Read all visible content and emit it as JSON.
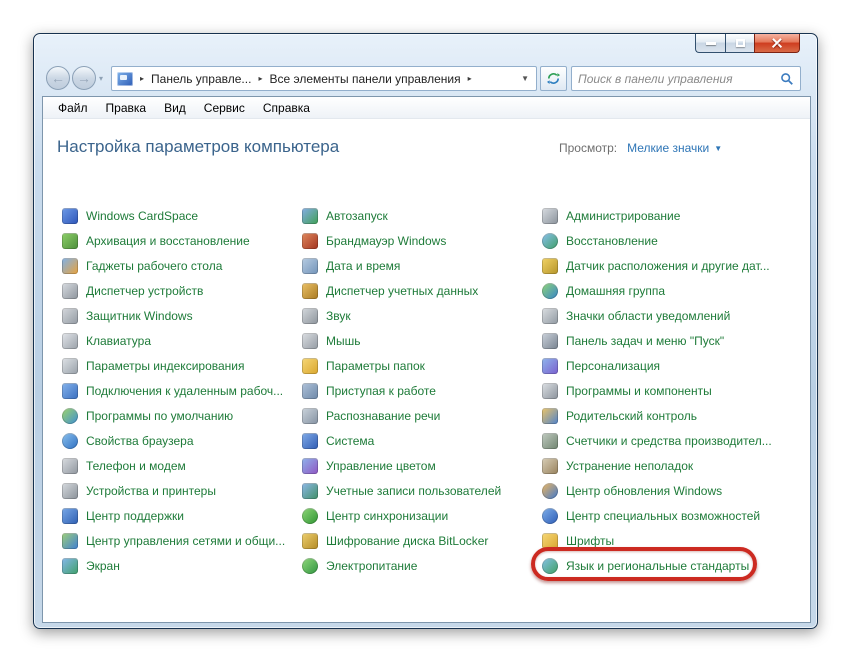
{
  "navigation": {
    "breadcrumb": {
      "items": [
        "Панель управле...",
        "Все элементы панели управления"
      ]
    },
    "search": {
      "placeholder": "Поиск в панели управления"
    }
  },
  "menu": {
    "items": [
      "Файл",
      "Правка",
      "Вид",
      "Сервис",
      "Справка"
    ]
  },
  "page": {
    "title": "Настройка параметров компьютера",
    "view_label": "Просмотр:",
    "view_value": "Мелкие значки"
  },
  "colors": {
    "item_link": "#1e7b39",
    "page_title": "#3b648c",
    "view_link": "#2e75b6",
    "view_label": "#6e6e6e",
    "menu_text": "#000000",
    "placeholder_gray": "#8a8a8a",
    "highlight_red": "#cc2a21"
  },
  "columns": [
    {
      "items": [
        {
          "label": "Windows CardSpace",
          "icon": "cardspace",
          "shape": "square",
          "colors": [
            "#6f9ce8",
            "#2d55b8"
          ]
        },
        {
          "label": "Архивация и восстановление",
          "icon": "backup-restore",
          "shape": "square",
          "colors": [
            "#8fd06a",
            "#4c8f3a"
          ]
        },
        {
          "label": "Гаджеты рабочего стола",
          "icon": "desktop-gadgets",
          "shape": "square",
          "colors": [
            "#7fb2ea",
            "#e9a23b"
          ]
        },
        {
          "label": "Диспетчер устройств",
          "icon": "device-manager",
          "shape": "square",
          "colors": [
            "#d9dde2",
            "#8d949c"
          ]
        },
        {
          "label": "Защитник Windows",
          "icon": "windows-defender",
          "shape": "square",
          "colors": [
            "#d6d9dd",
            "#939aa3"
          ]
        },
        {
          "label": "Клавиатура",
          "icon": "keyboard",
          "shape": "square",
          "colors": [
            "#e3e6ea",
            "#9aa1a9"
          ]
        },
        {
          "label": "Параметры индексирования",
          "icon": "indexing-options",
          "shape": "square",
          "colors": [
            "#dfe3e7",
            "#98a0a8"
          ]
        },
        {
          "label": "Подключения к удаленным рабоч...",
          "icon": "remote-desktop",
          "shape": "square",
          "colors": [
            "#86b4ec",
            "#3a6fc0"
          ]
        },
        {
          "label": "Программы по умолчанию",
          "icon": "default-programs",
          "shape": "circle",
          "colors": [
            "#9fd66a",
            "#3f8fd2"
          ]
        },
        {
          "label": "Свойства браузера",
          "icon": "internet-options",
          "shape": "circle",
          "colors": [
            "#8cc2ee",
            "#2d6fc2"
          ]
        },
        {
          "label": "Телефон и модем",
          "icon": "phone-modem",
          "shape": "square",
          "colors": [
            "#dadde1",
            "#8f969e"
          ]
        },
        {
          "label": "Устройства и принтеры",
          "icon": "devices-printers",
          "shape": "square",
          "colors": [
            "#d7dbdf",
            "#8a9199"
          ]
        },
        {
          "label": "Центр поддержки",
          "icon": "action-center-flag",
          "shape": "square",
          "colors": [
            "#79a9e8",
            "#2f5fb2"
          ]
        },
        {
          "label": "Центр управления сетями и общи...",
          "icon": "network-sharing-center",
          "shape": "square",
          "colors": [
            "#9fd07a",
            "#3f7fd2"
          ]
        },
        {
          "label": "Экран",
          "icon": "display",
          "shape": "square",
          "colors": [
            "#86b8ec",
            "#3f9f6a"
          ]
        }
      ]
    },
    {
      "items": [
        {
          "label": "Автозапуск",
          "icon": "autoplay",
          "shape": "square",
          "colors": [
            "#86aee8",
            "#3f9f55"
          ]
        },
        {
          "label": "Брандмауэр Windows",
          "icon": "windows-firewall",
          "shape": "square",
          "colors": [
            "#e08a5f",
            "#a33420"
          ]
        },
        {
          "label": "Дата и время",
          "icon": "date-time",
          "shape": "square",
          "colors": [
            "#b8cde3",
            "#7293b8"
          ]
        },
        {
          "label": "Диспетчер учетных данных",
          "icon": "credential-manager",
          "shape": "square",
          "colors": [
            "#ecc268",
            "#a97a22"
          ]
        },
        {
          "label": "Звук",
          "icon": "sound-speaker",
          "shape": "square",
          "colors": [
            "#d5d9dd",
            "#8d949c"
          ]
        },
        {
          "label": "Мышь",
          "icon": "mouse",
          "shape": "square",
          "colors": [
            "#dcdfe3",
            "#949ba3"
          ]
        },
        {
          "label": "Параметры папок",
          "icon": "folder-options",
          "shape": "square",
          "colors": [
            "#f6d878",
            "#d9a62e"
          ]
        },
        {
          "label": "Приступая к работе",
          "icon": "getting-started",
          "shape": "square",
          "colors": [
            "#b0c3da",
            "#6d88a8"
          ]
        },
        {
          "label": "Распознавание речи",
          "icon": "speech-recognition",
          "shape": "square",
          "colors": [
            "#ccd4dc",
            "#8492a2"
          ]
        },
        {
          "label": "Система",
          "icon": "system",
          "shape": "square",
          "colors": [
            "#82ace8",
            "#2f5cb4"
          ]
        },
        {
          "label": "Управление цветом",
          "icon": "color-management",
          "shape": "square",
          "colors": [
            "#8fb4ec",
            "#8f55c2"
          ]
        },
        {
          "label": "Учетные записи пользователей",
          "icon": "user-accounts",
          "shape": "square",
          "colors": [
            "#8fb8e8",
            "#3f8f68"
          ]
        },
        {
          "label": "Центр синхронизации",
          "icon": "sync-center",
          "shape": "circle",
          "colors": [
            "#8fd878",
            "#2f9433"
          ]
        },
        {
          "label": "Шифрование диска BitLocker",
          "icon": "bitlocker",
          "shape": "square",
          "colors": [
            "#eed070",
            "#b38a24"
          ]
        },
        {
          "label": "Электропитание",
          "icon": "power-options",
          "shape": "circle",
          "colors": [
            "#92da7c",
            "#2f9440"
          ]
        }
      ]
    },
    {
      "items": [
        {
          "label": "Администрирование",
          "icon": "administrative-tools",
          "shape": "square",
          "colors": [
            "#d9dde2",
            "#8a929b"
          ]
        },
        {
          "label": "Восстановление",
          "icon": "recovery",
          "shape": "circle",
          "colors": [
            "#8cc0ee",
            "#3f9f68"
          ]
        },
        {
          "label": "Датчик расположения и другие дат...",
          "icon": "location-sensors",
          "shape": "square",
          "colors": [
            "#f2d366",
            "#b5952a"
          ]
        },
        {
          "label": "Домашняя группа",
          "icon": "homegroup",
          "shape": "circle",
          "colors": [
            "#92d678",
            "#3584c8"
          ]
        },
        {
          "label": "Значки области уведомлений",
          "icon": "notification-area-icons",
          "shape": "square",
          "colors": [
            "#dcdfe3",
            "#9099a1"
          ]
        },
        {
          "label": "Панель задач и меню \"Пуск\"",
          "icon": "taskbar-start-menu",
          "shape": "square",
          "colors": [
            "#ccd3dc",
            "#77828f"
          ]
        },
        {
          "label": "Персонализация",
          "icon": "personalization",
          "shape": "square",
          "colors": [
            "#8fb6ec",
            "#7a5fce"
          ]
        },
        {
          "label": "Программы и компоненты",
          "icon": "programs-features",
          "shape": "square",
          "colors": [
            "#dde1e5",
            "#8b929b"
          ]
        },
        {
          "label": "Родительский контроль",
          "icon": "parental-controls",
          "shape": "square",
          "colors": [
            "#eec668",
            "#4f82ca"
          ]
        },
        {
          "label": "Счетчики и средства производител...",
          "icon": "performance-tools",
          "shape": "square",
          "colors": [
            "#c2ccc2",
            "#6f846f"
          ]
        },
        {
          "label": "Устранение неполадок",
          "icon": "troubleshooting",
          "shape": "square",
          "colors": [
            "#d9cfb8",
            "#97815c"
          ]
        },
        {
          "label": "Центр обновления Windows",
          "icon": "windows-update",
          "shape": "circle",
          "colors": [
            "#f0b860",
            "#3f78cc"
          ]
        },
        {
          "label": "Центр специальных возможностей",
          "icon": "ease-of-access",
          "shape": "circle",
          "colors": [
            "#7fb0ea",
            "#2d5cb6"
          ]
        },
        {
          "label": "Шрифты",
          "icon": "fonts",
          "shape": "square",
          "colors": [
            "#f6d878",
            "#d9a62e"
          ]
        },
        {
          "label": "Язык и региональные стандарты",
          "icon": "region-language",
          "shape": "circle",
          "colors": [
            "#86c2e8",
            "#3f9f62"
          ],
          "highlight": true
        }
      ]
    }
  ]
}
